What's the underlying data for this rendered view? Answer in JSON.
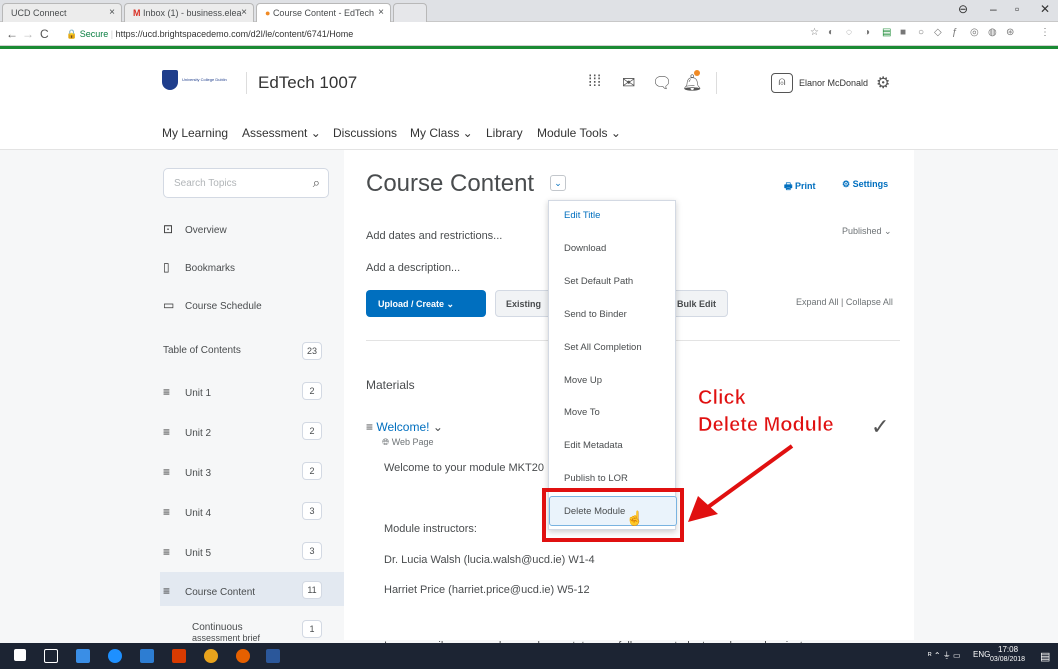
{
  "browser": {
    "tabs": [
      {
        "label": "UCD Connect"
      },
      {
        "label": "Inbox (1) - business.elea"
      },
      {
        "label": "Course Content - EdTech"
      }
    ],
    "url_secure": "Secure",
    "url": "https://ucd.brightspacedemo.com/d2l/le/content/6741/Home"
  },
  "header": {
    "logo_text": "University College Dublin",
    "course_title": "EdTech 1007",
    "user_name": "Elanor McDonald"
  },
  "topnav": {
    "items": [
      "My Learning",
      "Assessment ⌄",
      "Discussions",
      "My Class ⌄",
      "Library",
      "Module Tools ⌄"
    ]
  },
  "sidebar": {
    "search_placeholder": "Search Topics",
    "overview": "Overview",
    "bookmarks": "Bookmarks",
    "schedule": "Course Schedule",
    "toc": {
      "label": "Table of Contents",
      "count": "23"
    },
    "units": [
      {
        "label": "Unit 1",
        "count": "2"
      },
      {
        "label": "Unit 2",
        "count": "2"
      },
      {
        "label": "Unit 3",
        "count": "2"
      },
      {
        "label": "Unit 4",
        "count": "3"
      },
      {
        "label": "Unit 5",
        "count": "3"
      },
      {
        "label": "Course Content",
        "count": "11"
      }
    ],
    "sub": {
      "label": "Continuous",
      "label2": "assessment brief",
      "count": "1"
    }
  },
  "main": {
    "title": "Course Content",
    "print": "Print",
    "settings": "Settings",
    "add_dates": "Add dates and restrictions...",
    "published": "Published",
    "add_desc": "Add a description...",
    "upload": "Upload / Create",
    "existing": "Existing",
    "bulk_edit": "Bulk Edit",
    "expand_all": "Expand All",
    "collapse_all": "Collapse All",
    "materials": "Materials",
    "welcome": "Welcome!",
    "web_page": "Web Page",
    "welcome_text": "Welcome to your module MKT20",
    "instructors": "Module instructors:",
    "instr1": "Dr. Lucia Walsh (lucia.walsh@ucd.ie) W1-4",
    "instr2": "Harriet Price (harriet.price@ucd.ie) W5-12",
    "footer_text": "In any email correspondence, please state your full name, student number and project group"
  },
  "menu": {
    "items": [
      "Edit Title",
      "Download",
      "Set Default Path",
      "Send to Binder",
      "Set All Completion",
      "Move Up",
      "Move To",
      "Edit Metadata",
      "Publish to LOR",
      "Delete Module"
    ]
  },
  "annotation": {
    "line1": "Click",
    "line2": "Delete Module"
  },
  "taskbar": {
    "lang": "ENG",
    "time": "17:08",
    "date": "03/08/2018"
  },
  "colors": {
    "accent": "#006fbf",
    "highlight": "#e01010",
    "brand_bar": "#1a8a34"
  }
}
